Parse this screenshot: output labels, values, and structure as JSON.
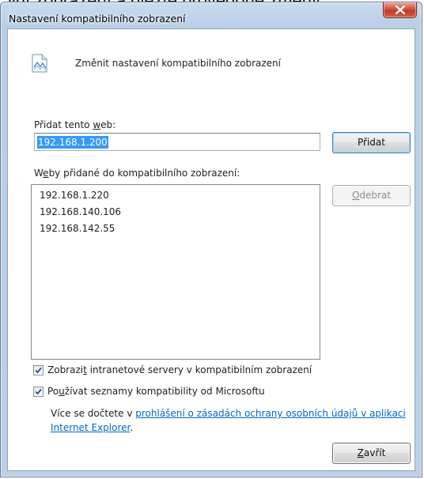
{
  "background": {
    "partial_text": "ilní zobrazení a dlezte provedoné změny."
  },
  "window": {
    "title": "Nastavení kompatibilního zobrazení"
  },
  "header": {
    "text": "Změnit nastavení kompatibilního zobrazení",
    "icon": "document-settings-icon"
  },
  "add_site": {
    "label_before": "Přidat tento ",
    "label_accel": "w",
    "label_after": "eb:",
    "value": "192.168.1.200",
    "button_label": "Přidat"
  },
  "site_list": {
    "label_before": "W",
    "label_accel": "e",
    "label_after": "by přidané do kompatibilního zobrazení:",
    "items": [
      "192.168.1.220",
      "192.168.140.106",
      "192.168.142.55"
    ],
    "remove_accel": "O",
    "remove_rest": "debrat"
  },
  "options": {
    "intranet": {
      "checked": true,
      "before": "Zobrazi",
      "accel": "t",
      "after": " intranetové servery v kompatibilním zobrazení"
    },
    "microsoft": {
      "checked": true,
      "before": "Po",
      "accel": "u",
      "after": "žívat seznamy kompatibility od Microsoftu"
    }
  },
  "info": {
    "text_before": "Více se dočtete v ",
    "link_text": "prohlášení o zásadách ochrany osobních údajů v aplikaci Internet Explorer",
    "text_after": "."
  },
  "close_button": {
    "accel": "Z",
    "rest": "avřít"
  },
  "colors": {
    "selection": "#3399ff",
    "link": "#0066cc",
    "close_button_red": "#c23a24"
  }
}
